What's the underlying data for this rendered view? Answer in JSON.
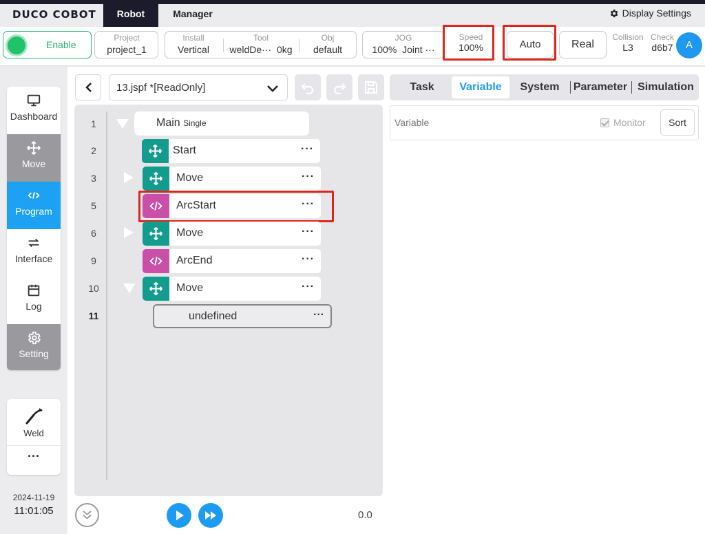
{
  "app": {
    "brand": "DUCO COBOT",
    "tabs": [
      {
        "label": "Robot"
      },
      {
        "label": "Manager"
      }
    ],
    "display_settings": "Display Settings"
  },
  "status": {
    "enable": "Enable",
    "project": {
      "caption": "Project",
      "value": "project_1"
    },
    "install": {
      "caption": "Install",
      "value": "Vertical"
    },
    "tool": {
      "caption": "Tool",
      "value": "weldDe···",
      "weight": "0kg"
    },
    "obj": {
      "caption": "Obj",
      "value": "default"
    },
    "jog": {
      "caption": "JOG",
      "value": "100%",
      "mode": "Joint ···"
    },
    "speed": {
      "caption": "Speed",
      "value": "100%"
    },
    "auto": "Auto",
    "real": "Real",
    "collision": {
      "caption": "Collision",
      "value": "L3"
    },
    "check": {
      "caption": "Check",
      "value": "d6b7"
    },
    "avatar": "A"
  },
  "sidebar": {
    "items": [
      {
        "label": "Dashboard",
        "icon": "monitor-icon"
      },
      {
        "label": "Move",
        "icon": "move-arrows-icon"
      },
      {
        "label": "Program",
        "icon": "code-icon"
      },
      {
        "label": "Interface",
        "icon": "swap-icon"
      },
      {
        "label": "Log",
        "icon": "calendar-icon"
      },
      {
        "label": "Setting",
        "icon": "gear-icon"
      }
    ],
    "weld": "Weld",
    "more": "···",
    "date": "2024-11-19",
    "time": "11:01:05"
  },
  "editor": {
    "file": "13.jspf *[ReadOnly]",
    "runtime": "0.0",
    "tree": [
      {
        "line": "1",
        "label": "Main",
        "sub": "Single",
        "type": "main"
      },
      {
        "line": "2",
        "label": "Start",
        "type": "move"
      },
      {
        "line": "3",
        "label": "Move",
        "type": "move"
      },
      {
        "line": "5",
        "label": "ArcStart",
        "type": "code"
      },
      {
        "line": "6",
        "label": "Move",
        "type": "move"
      },
      {
        "line": "9",
        "label": "ArcEnd",
        "type": "code"
      },
      {
        "line": "10",
        "label": "Move",
        "type": "move"
      },
      {
        "line": "11",
        "label": "undefined",
        "type": "undefined"
      }
    ],
    "more": "···"
  },
  "right": {
    "tabs": [
      {
        "label": "Task"
      },
      {
        "label": "Variable"
      },
      {
        "label": "System"
      },
      {
        "label": "Parameter"
      },
      {
        "label": "Simulation"
      }
    ],
    "variable_header": "Variable",
    "monitor": "Monitor",
    "sort": "Sort"
  },
  "colors": {
    "accent": "#1d9bf0",
    "move_badge": "#139b8d",
    "code_badge": "#c94fa9",
    "enable_green": "#20c26a",
    "highlight_red": "#e0251b"
  }
}
